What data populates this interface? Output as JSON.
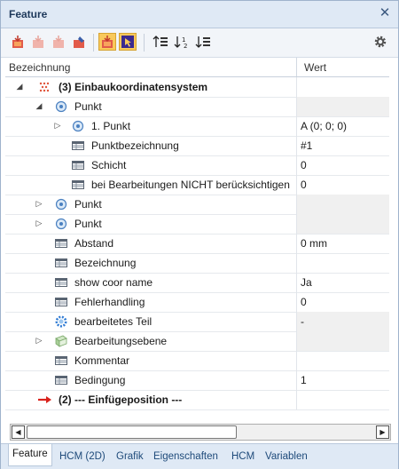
{
  "window": {
    "title": "Feature"
  },
  "toolbar": {
    "icons": [
      "feature-add-icon",
      "feature-disabled-icon",
      "feature-disabled-icon",
      "feature-edit-icon",
      "feature-active-icon",
      "cursor-arrow-icon",
      "sort-ascending-icon",
      "sort-numeric-icon",
      "sort-descending-icon",
      "gear-icon"
    ]
  },
  "columns": {
    "name": "Bezeichnung",
    "value": "Wert"
  },
  "rows": [
    {
      "label": "(3) Einbaukoordinatensystem",
      "value": ""
    },
    {
      "label": "Punkt",
      "value": ""
    },
    {
      "label": "1. Punkt",
      "value": "A  (0; 0; 0)"
    },
    {
      "label": "Punktbezeichnung",
      "value": "#1"
    },
    {
      "label": "Schicht",
      "value": "0"
    },
    {
      "label": "bei Bearbeitungen NICHT berücksichtigen",
      "value": "0"
    },
    {
      "label": "Punkt",
      "value": ""
    },
    {
      "label": "Punkt",
      "value": ""
    },
    {
      "label": "Abstand",
      "value": "0 mm"
    },
    {
      "label": "Bezeichnung",
      "value": ""
    },
    {
      "label": "show coor name",
      "value": "Ja"
    },
    {
      "label": "Fehlerhandling",
      "value": "0"
    },
    {
      "label": "bearbeitetes Teil",
      "value": "-"
    },
    {
      "label": "Bearbeitungsebene",
      "value": ""
    },
    {
      "label": "Kommentar",
      "value": ""
    },
    {
      "label": "Bedingung",
      "value": "1"
    },
    {
      "label": "(2) --- Einfügeposition ---",
      "value": ""
    }
  ],
  "tabs": [
    "Feature",
    "HCM (2D)",
    "Grafik",
    "Eigenschaften",
    "HCM",
    "Variablen"
  ],
  "colors": {
    "accent": "#f9c95b",
    "titlebar": "#dfe9f5",
    "link": "#1e4a7a",
    "arrow_red": "#d9221c"
  }
}
